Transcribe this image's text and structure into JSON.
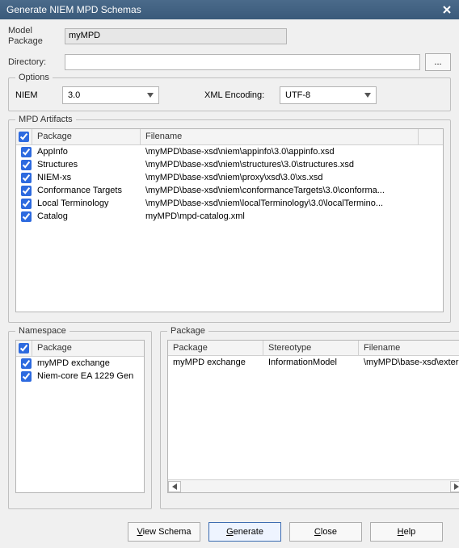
{
  "window": {
    "title": "Generate NIEM MPD Schemas"
  },
  "fields": {
    "model_package_label": "Model Package",
    "model_package_value": "myMPD",
    "directory_label": "Directory:",
    "directory_value": "",
    "browse_label": "..."
  },
  "options": {
    "legend": "Options",
    "niem_label": "NIEM",
    "niem_value": "3.0",
    "xml_encoding_label": "XML Encoding:",
    "xml_encoding_value": "UTF-8"
  },
  "artifacts": {
    "legend": "MPD Artifacts",
    "columns": {
      "package": "Package",
      "filename": "Filename"
    },
    "rows": [
      {
        "checked": true,
        "package": "AppInfo",
        "filename": "\\myMPD\\base-xsd\\niem\\appinfo\\3.0\\appinfo.xsd"
      },
      {
        "checked": true,
        "package": "Structures",
        "filename": "\\myMPD\\base-xsd\\niem\\structures\\3.0\\structures.xsd"
      },
      {
        "checked": true,
        "package": "NIEM-xs",
        "filename": "\\myMPD\\base-xsd\\niem\\proxy\\xsd\\3.0\\xs.xsd"
      },
      {
        "checked": true,
        "package": "Conformance Targets",
        "filename": "\\myMPD\\base-xsd\\niem\\conformanceTargets\\3.0\\conforma..."
      },
      {
        "checked": true,
        "package": "Local Terminology",
        "filename": "\\myMPD\\base-xsd\\niem\\localTerminology\\3.0\\localTermino..."
      },
      {
        "checked": true,
        "package": "Catalog",
        "filename": "myMPD\\mpd-catalog.xml"
      }
    ]
  },
  "namespace": {
    "legend": "Namespace",
    "columns": {
      "package": "Package"
    },
    "rows": [
      {
        "checked": true,
        "package": "myMPD exchange"
      },
      {
        "checked": true,
        "package": "Niem-core EA 1229 Gen"
      }
    ]
  },
  "package_panel": {
    "legend": "Package",
    "columns": {
      "package": "Package",
      "stereotype": "Stereotype",
      "filename": "Filename"
    },
    "rows": [
      {
        "package": "myMPD exchange",
        "stereotype": "InformationModel",
        "filename": "\\myMPD\\base-xsd\\exter"
      }
    ]
  },
  "buttons": {
    "view_schema": "View Schema",
    "generate": "Generate",
    "close": "Close",
    "help": "Help"
  }
}
